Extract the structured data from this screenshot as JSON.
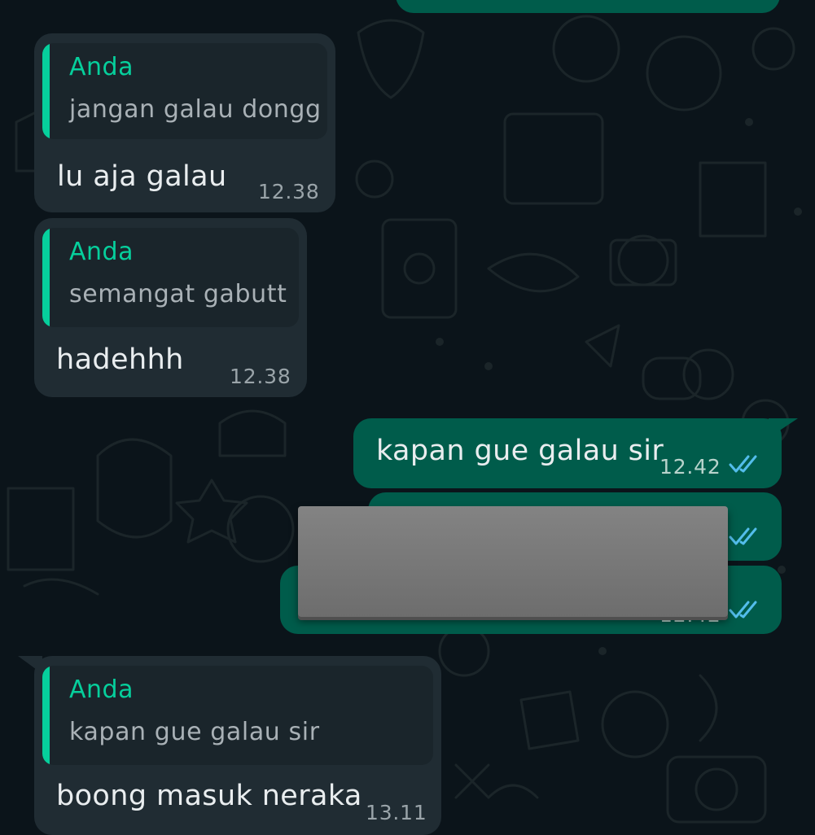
{
  "colors": {
    "background": "#0b141a",
    "incoming_bubble": "#202c33",
    "outgoing_bubble": "#005c4b",
    "quote_accent": "#06cf9c",
    "read_ticks": "#53bdeb"
  },
  "messages": [
    {
      "direction": "incoming",
      "quote": {
        "author": "Anda",
        "text": "jangan galau dongg"
      },
      "text": "lu aja galau",
      "time": "12.38"
    },
    {
      "direction": "incoming",
      "quote": {
        "author": "Anda",
        "text": "semangat gabutt"
      },
      "text": "hadehhh",
      "time": "12.38"
    },
    {
      "direction": "outgoing",
      "text": "kapan gue galau sir",
      "time": "12.42",
      "status_icon": "double-check-read-icon"
    },
    {
      "direction": "outgoing",
      "text": "",
      "time": "",
      "status_icon": "double-check-read-icon",
      "redacted": true
    },
    {
      "direction": "outgoing",
      "text": "",
      "time": "12.42",
      "status_icon": "double-check-read-icon",
      "redacted": true
    },
    {
      "direction": "incoming",
      "quote": {
        "author": "Anda",
        "text": "kapan gue galau sir"
      },
      "text": "boong masuk neraka",
      "time": "13.11"
    }
  ]
}
